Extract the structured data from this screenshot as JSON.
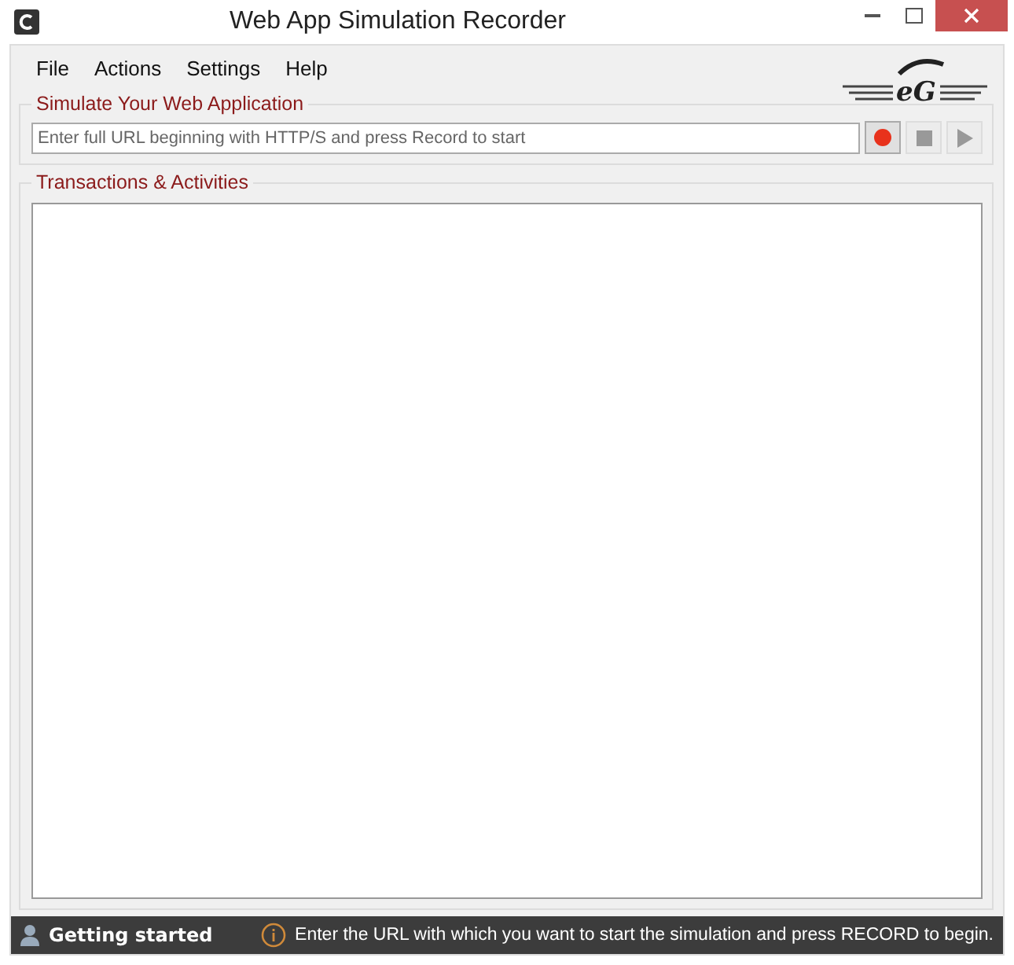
{
  "window": {
    "title": "Web App Simulation Recorder"
  },
  "menu": [
    "File",
    "Actions",
    "Settings",
    "Help"
  ],
  "logo": {
    "text": "eG"
  },
  "simulate": {
    "title": "Simulate Your Web Application",
    "placeholder": "Enter full URL beginning with HTTP/S and press Record to start",
    "buttons": [
      {
        "kind": "record",
        "disabled": false
      },
      {
        "kind": "stop",
        "disabled": true
      },
      {
        "kind": "play",
        "disabled": true
      }
    ]
  },
  "transactions": {
    "title": "Transactions & Activities"
  },
  "status_bar": {
    "title": "Getting started",
    "message": "Enter the URL with which you want to start the simulation and press RECORD to begin."
  }
}
